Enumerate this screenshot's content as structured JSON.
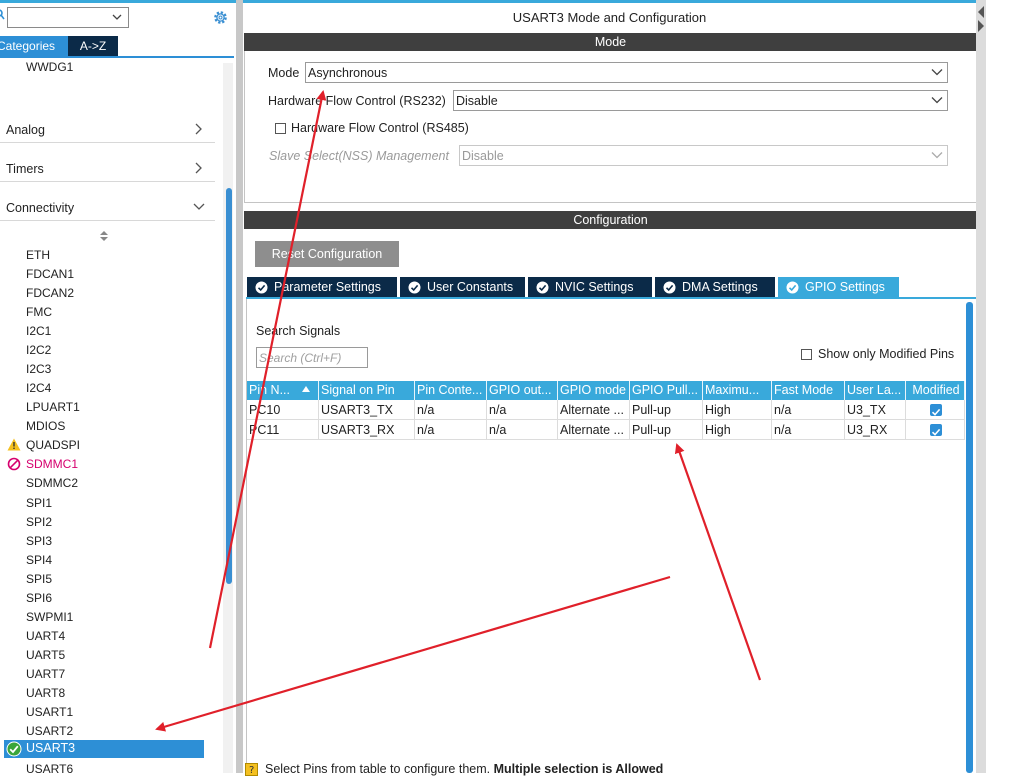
{
  "left_panel": {
    "search_value": "",
    "tabs": {
      "categories": "Categories",
      "az": "A->Z"
    },
    "top_item": "WWDG1",
    "categories": [
      {
        "label": "Analog",
        "expanded": false
      },
      {
        "label": "Timers",
        "expanded": false
      },
      {
        "label": "Connectivity",
        "expanded": true
      }
    ],
    "connectivity_items": [
      "ETH",
      "FDCAN1",
      "FDCAN2",
      "FMC",
      "I2C1",
      "I2C2",
      "I2C3",
      "I2C4",
      "LPUART1",
      "MDIOS",
      "QUADSPI",
      "SDMMC1",
      "SDMMC2",
      "SPI1",
      "SPI2",
      "SPI3",
      "SPI4",
      "SPI5",
      "SPI6",
      "SWPMI1",
      "UART4",
      "UART5",
      "UART7",
      "UART8",
      "USART1",
      "USART2",
      "USART3",
      "USART6"
    ],
    "selected_item": "USART3",
    "colors": {
      "accent": "#2d8fd6",
      "warning": "#f4c020",
      "disabled": "#d6006e",
      "ok": "#3aa53a"
    }
  },
  "right_panel": {
    "title": "USART3 Mode and Configuration",
    "mode_band": "Mode",
    "mode": {
      "mode_label": "Mode",
      "mode_value": "Asynchronous",
      "hw_flow_rs232_label": "Hardware Flow Control (RS232)",
      "hw_flow_rs232_value": "Disable",
      "hw_flow_rs485_label": "Hardware Flow Control (RS485)",
      "hw_flow_rs485_checked": false,
      "slave_select_label": "Slave Select(NSS) Management",
      "slave_select_value": "Disable"
    },
    "config_band": "Configuration",
    "reset_button": "Reset Configuration",
    "tabs": [
      {
        "label": "Parameter Settings",
        "active": false
      },
      {
        "label": "User Constants",
        "active": false
      },
      {
        "label": "NVIC Settings",
        "active": false
      },
      {
        "label": "DMA Settings",
        "active": false
      },
      {
        "label": "GPIO Settings",
        "active": true
      }
    ],
    "search_signals_label": "Search Signals",
    "search_placeholder": "Search (Ctrl+F)",
    "show_modified_label": "Show only Modified Pins",
    "table": {
      "columns": [
        "Pin N...",
        "Signal on Pin",
        "Pin Conte...",
        "GPIO out...",
        "GPIO mode",
        "GPIO Pull...",
        "Maximu...",
        "Fast Mode",
        "User La...",
        "Modified"
      ],
      "rows": [
        [
          "PC10",
          "USART3_TX",
          "n/a",
          "n/a",
          "Alternate ...",
          "Pull-up",
          "High",
          "n/a",
          "U3_TX",
          "checked"
        ],
        [
          "PC11",
          "USART3_RX",
          "n/a",
          "n/a",
          "Alternate ...",
          "Pull-up",
          "High",
          "n/a",
          "U3_RX",
          "checked"
        ]
      ]
    },
    "bottom_message": "Select Pins from table to configure them.",
    "bottom_message_bold": "Multiple selection is Allowed"
  },
  "annotation_color": "#e0202a"
}
